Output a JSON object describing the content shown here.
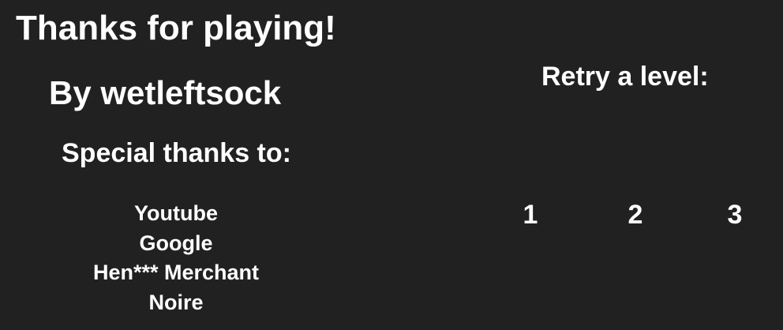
{
  "title": "Thanks for playing!",
  "author": "By wetleftsock",
  "special_thanks": {
    "heading": "Special thanks to:",
    "names": [
      "Youtube",
      "Google",
      "Hen*** Merchant",
      "Noire"
    ]
  },
  "retry": {
    "heading": "Retry a level:",
    "levels": [
      "1",
      "2",
      "3"
    ]
  },
  "colors": {
    "background": "#212121",
    "text": "#ffffff"
  }
}
